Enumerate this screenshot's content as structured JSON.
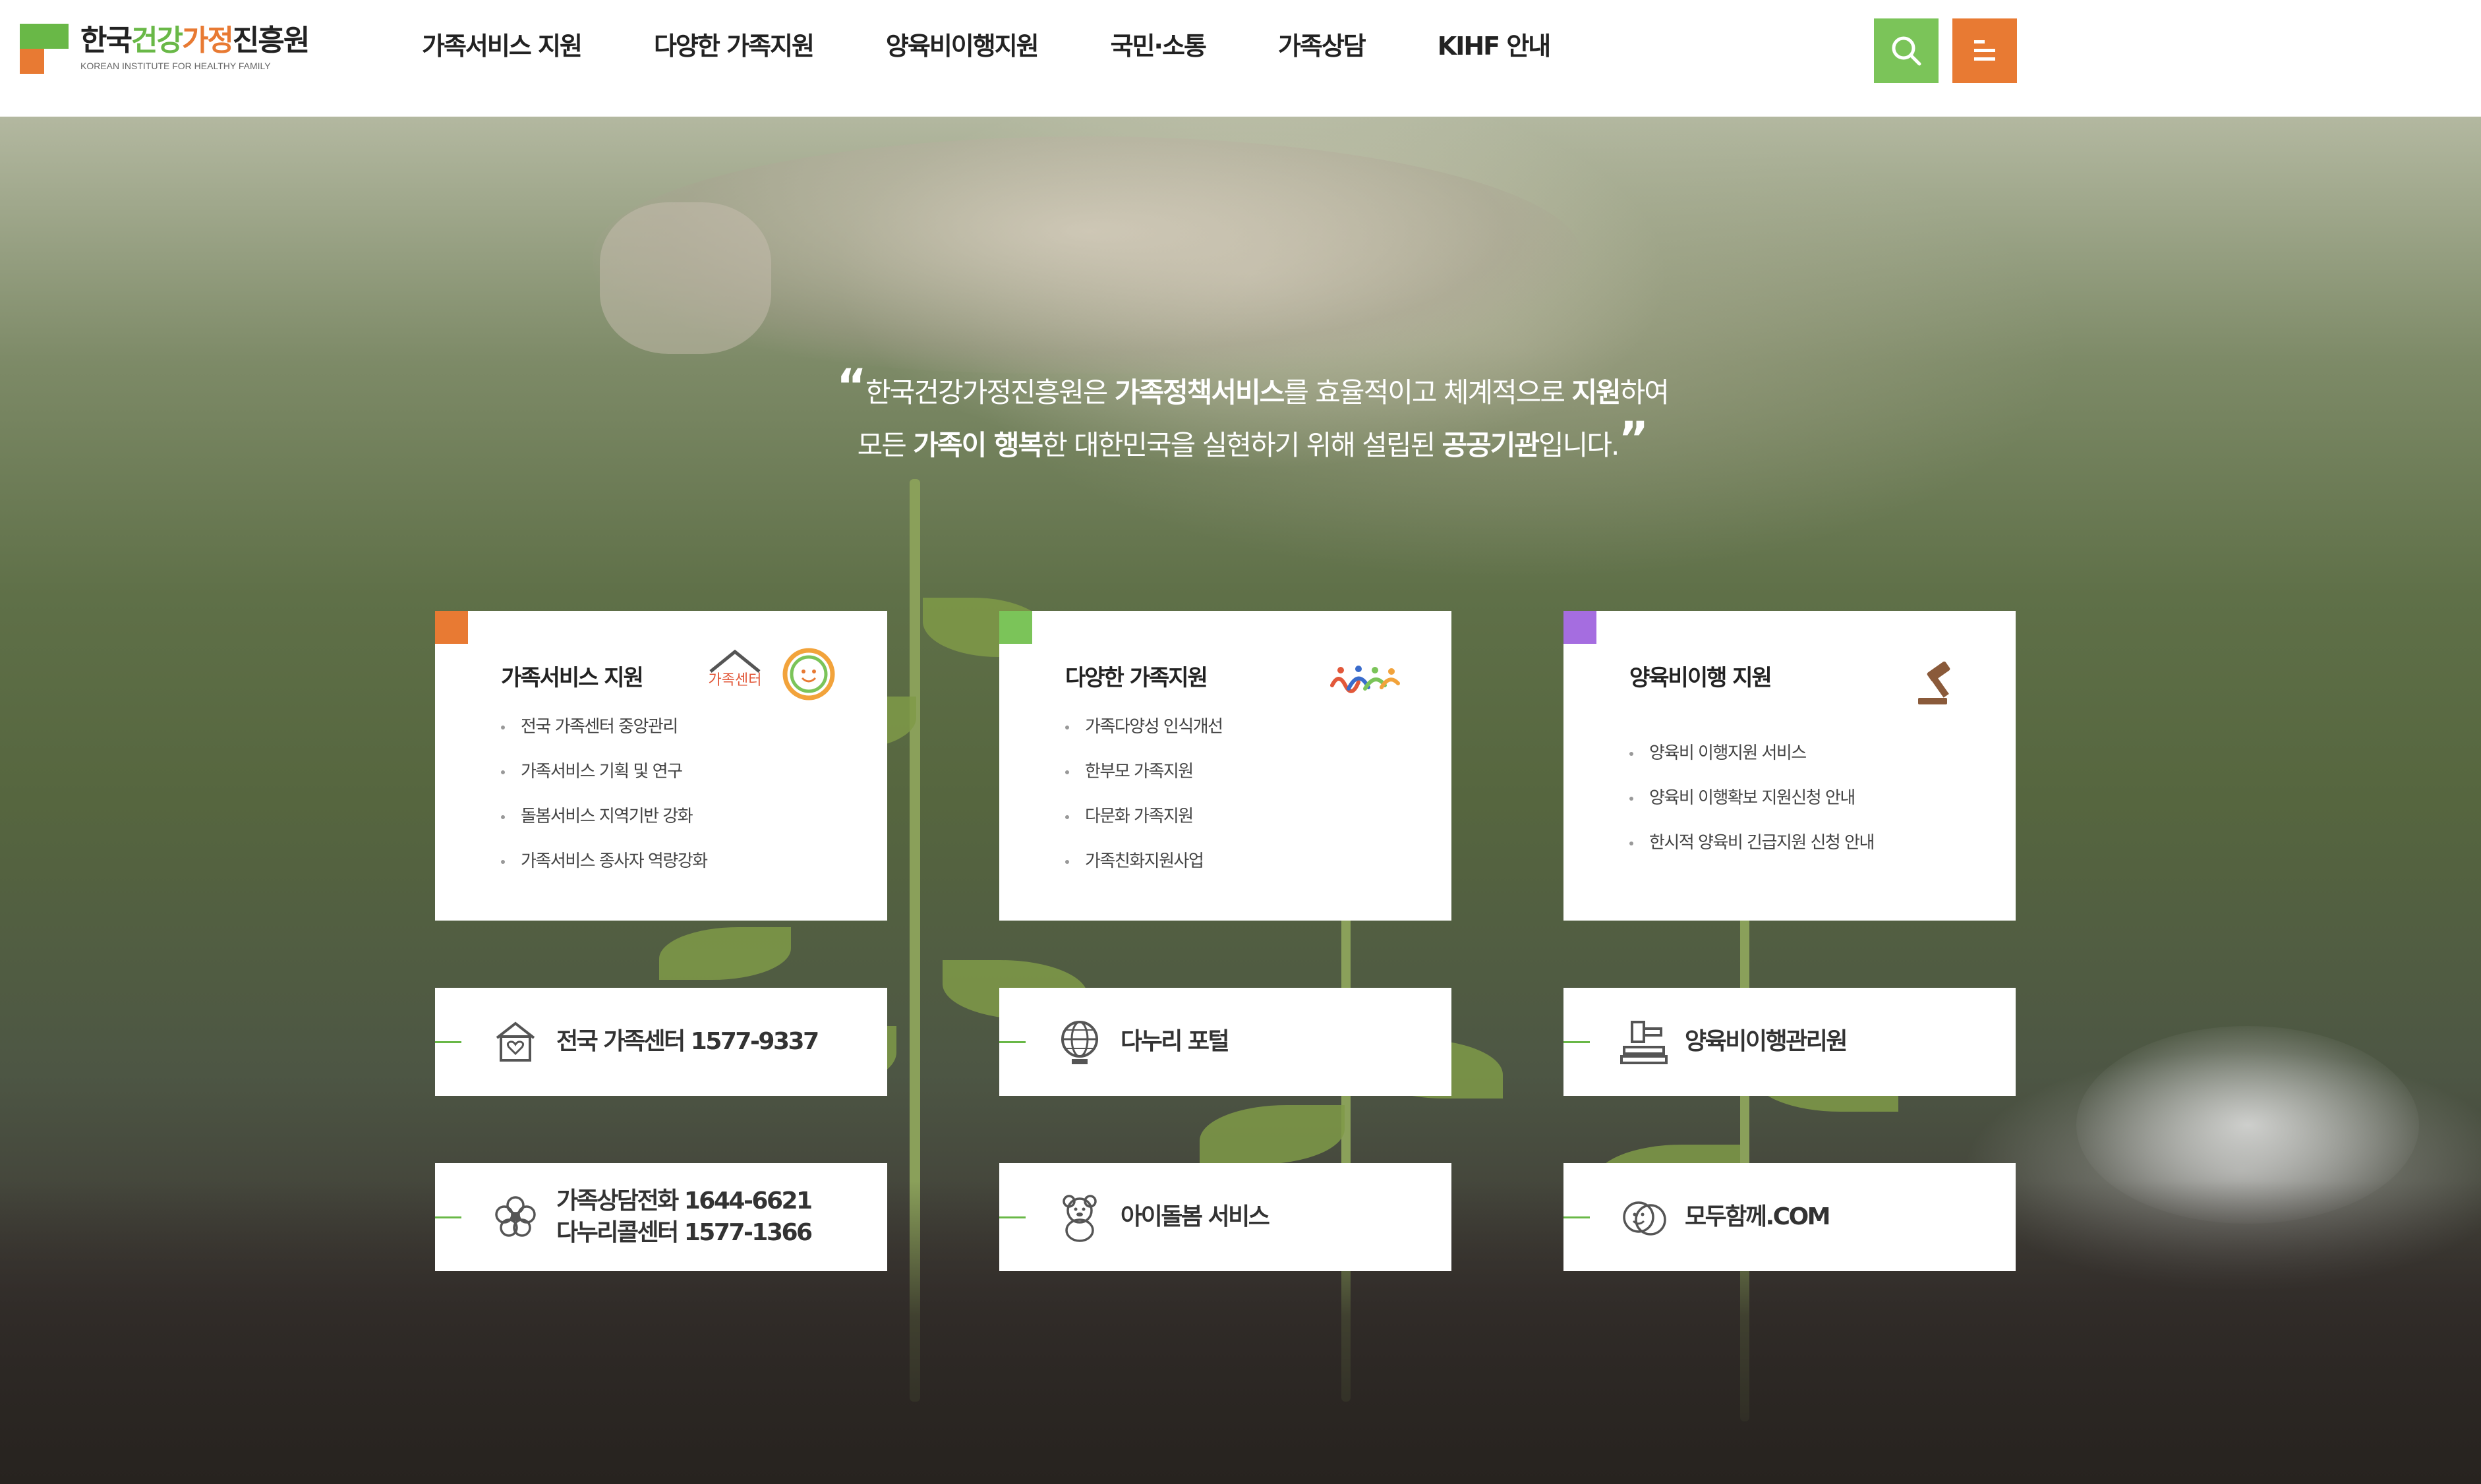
{
  "header": {
    "logo": {
      "title_parts": [
        "한국",
        "건강",
        "가정",
        "진흥원"
      ],
      "subtitle": "KOREAN INSTITUTE FOR HEALTHY FAMILY"
    },
    "nav": [
      {
        "label": "가족서비스 지원"
      },
      {
        "label": "다양한 가족지원"
      },
      {
        "label": "양육비이행지원"
      },
      {
        "label": "국민·소통"
      },
      {
        "label": "가족상담"
      },
      {
        "label": "KIHF 안내"
      }
    ],
    "search_icon": "search-icon",
    "menu_icon": "menu-icon",
    "colors": {
      "search": "#7bc459",
      "menu": "#e87a33"
    }
  },
  "quote": {
    "line1_a": "한국건강가정진흥원은 ",
    "line1_b": "가족정책서비스",
    "line1_c": "를 효율적이고 체계적으로 ",
    "line1_d": "지원",
    "line1_e": "하여",
    "line2_a": "모든 ",
    "line2_b": "가족이 행복",
    "line2_c": "한 대한민국을 실현하기 위해 설립된 ",
    "line2_d": "공공기관",
    "line2_e": "입니다."
  },
  "cards": [
    {
      "title": "가족서비스 지원",
      "accent": "#e87a33",
      "icon": "family-center-logo-icon",
      "icon_text": "가족센터",
      "items": [
        "전국 가족센터 중앙관리",
        "가족서비스 기획 및 연구",
        "돌봄서비스 지역기반 강화",
        "가족서비스 종사자 역량강화"
      ]
    },
    {
      "title": "다양한 가족지원",
      "accent": "#7bc459",
      "icon": "people-icon",
      "items": [
        "가족다양성 인식개선",
        "한부모 가족지원",
        "다문화 가족지원",
        "가족친화지원사업"
      ]
    },
    {
      "title": "양육비이행 지원",
      "accent": "#a56de0",
      "icon": "gavel-icon",
      "items": [
        "양육비 이행지원 서비스",
        "양육비 이행확보 지원신청 안내",
        "한시적 양육비 긴급지원 신청 안내"
      ]
    }
  ],
  "quick_links": [
    {
      "label": "전국 가족센터 1577-9337",
      "icon": "house-heart-icon"
    },
    {
      "label": "다누리 포털",
      "icon": "globe-icon"
    },
    {
      "label": "양육비이행관리원",
      "icon": "gavel-icon"
    },
    {
      "label_1": "가족상담전화 1644-6621",
      "label_2": "다누리콜센터 1577-1366",
      "icon": "flower-icon"
    },
    {
      "label": "아이돌봄 서비스",
      "icon": "teddy-bear-icon"
    },
    {
      "label": "모두함께.COM",
      "icon": "smile-faces-icon"
    }
  ]
}
